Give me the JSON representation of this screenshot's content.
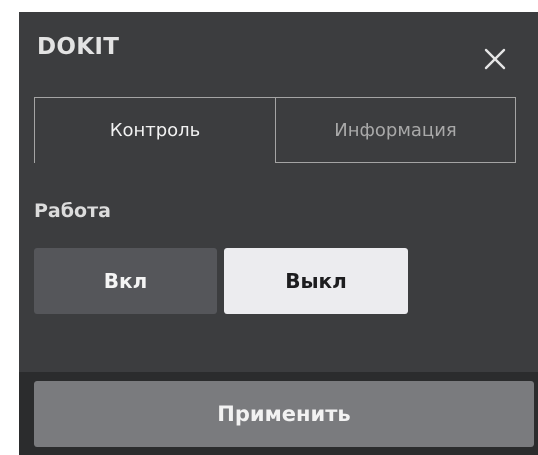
{
  "dialog": {
    "title": "DOKIT",
    "close_icon": "close-icon"
  },
  "tabs": [
    {
      "label": "Контроль",
      "active": true
    },
    {
      "label": "Информация",
      "active": false
    }
  ],
  "operation": {
    "label": "Работа",
    "options": [
      {
        "label": "Вкл",
        "selected": false
      },
      {
        "label": "Выкл",
        "selected": true
      }
    ]
  },
  "footer": {
    "apply_label": "Применить"
  },
  "colors": {
    "panel_bg": "#3c3d3f",
    "footer_bg": "#2b2c2d",
    "selected_option_bg": "#ececef",
    "unselected_option_bg": "#55565a",
    "apply_button_bg": "#7a7b7e"
  }
}
